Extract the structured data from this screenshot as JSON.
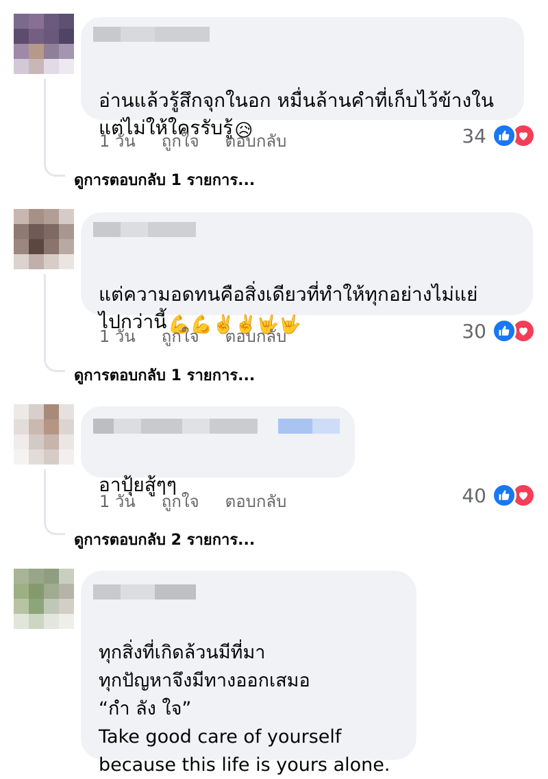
{
  "comments": [
    {
      "text": "อ่านแล้วรู้สึกจุกในอก หมื่นล้านคำที่เก็บไว้ข้างใน\nแต่ไม่ให้ใครรับรู้",
      "emoji": "😥",
      "time": "1 วัน",
      "like_label": "ถูกใจ",
      "reply_label": "ตอบกลับ",
      "reaction_count": "34",
      "view_replies": "ดูการตอบกลับ 1 รายการ..."
    },
    {
      "text": "แต่ความอดทนคือสิ่งเดียวที่ทำให้ทุกอย่างไม่แย่\nไปกว่านี้",
      "emoji": "💪💪✌️✌️🤟🤟",
      "time": "1 วัน",
      "like_label": "ถูกใจ",
      "reply_label": "ตอบกลับ",
      "reaction_count": "30",
      "view_replies": "ดูการตอบกลับ 1 รายการ..."
    },
    {
      "text": "อาปุ้ยสู้ๆๆ",
      "time": "1 วัน",
      "like_label": "ถูกใจ",
      "reply_label": "ตอบกลับ",
      "reaction_count": "40",
      "view_replies": "ดูการตอบกลับ 2 รายการ..."
    },
    {
      "text": "ทุกสิ่งที่เกิดล้วนมีที่มา\nทุกปัญหาจึงมีทางออกเสมอ\n“กำ ลัง ใจ”\nTake good care of yourself\nbecause this life is yours alone."
    }
  ],
  "icons": {
    "like": "thumbs-up-icon",
    "love": "heart-icon"
  },
  "colors": {
    "like": "#1877f2",
    "love": "#f33e58",
    "bubble": "#f0f2f5",
    "meta": "#65676b"
  }
}
